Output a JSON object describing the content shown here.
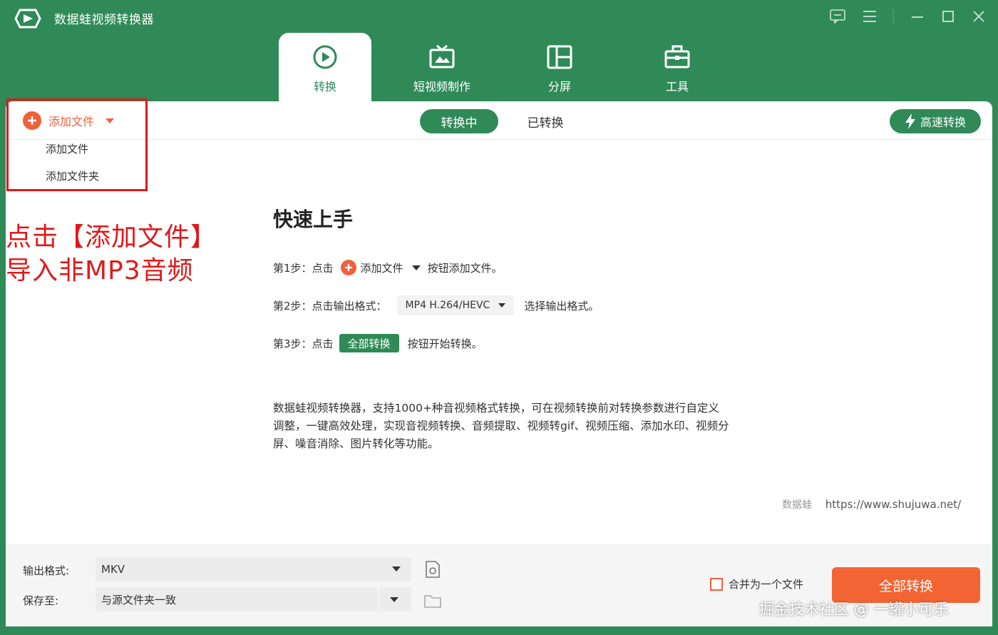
{
  "app": {
    "title": "数据蛙视频转换器"
  },
  "tabs": [
    {
      "label": "转换",
      "icon": "convert-icon",
      "active": true
    },
    {
      "label": "短视频制作",
      "icon": "tv-icon",
      "active": false
    },
    {
      "label": "分屏",
      "icon": "split-screen-icon",
      "active": false
    },
    {
      "label": "工具",
      "icon": "toolbox-icon",
      "active": false
    }
  ],
  "toolbar": {
    "add_file_label": "添加文件",
    "dropdown": [
      "添加文件",
      "添加文件夹"
    ],
    "status_tabs": [
      "转换中",
      "已转换"
    ],
    "fast_convert_label": "高速转换"
  },
  "annotation": {
    "line1": "点击【添加文件】",
    "line2": "导入非MP3音频"
  },
  "quickstart": {
    "title": "快速上手",
    "step1": {
      "prefix": "第1步：点击",
      "chip": "添加文件",
      "suffix": "按钮添加文件。"
    },
    "step2": {
      "prefix": "第2步：点击输出格式：",
      "chip": "MP4 H.264/HEVC",
      "suffix": "选择输出格式。"
    },
    "step3": {
      "prefix": "第3步：点击",
      "chip": "全部转换",
      "suffix": "按钮开始转换。"
    },
    "description": "数据蛙视频转换器，支持1000+种音视频格式转换，可在视频转换前对转换参数进行自定义调整，一键高效处理，实现音视频转换、音频提取、视频转gif、视频压缩、添加水印、视频分屏、噪音消除、图片转化等功能。",
    "site_brand": "数据蛙",
    "site_url": "https://www.shujuwa.net/"
  },
  "bottom": {
    "output_format_label": "输出格式:",
    "output_format_value": "MKV",
    "save_to_label": "保存至:",
    "save_to_value": "与源文件夹一致",
    "merge_label": "合并为一个文件",
    "merge_checked": false,
    "convert_all_label": "全部转换"
  },
  "watermark": "掘金技术社区 @ 一罐小可乐",
  "colors": {
    "brand_green": "#2f8a58",
    "accent_orange": "#f0603a",
    "annotation_red": "#e01919"
  }
}
